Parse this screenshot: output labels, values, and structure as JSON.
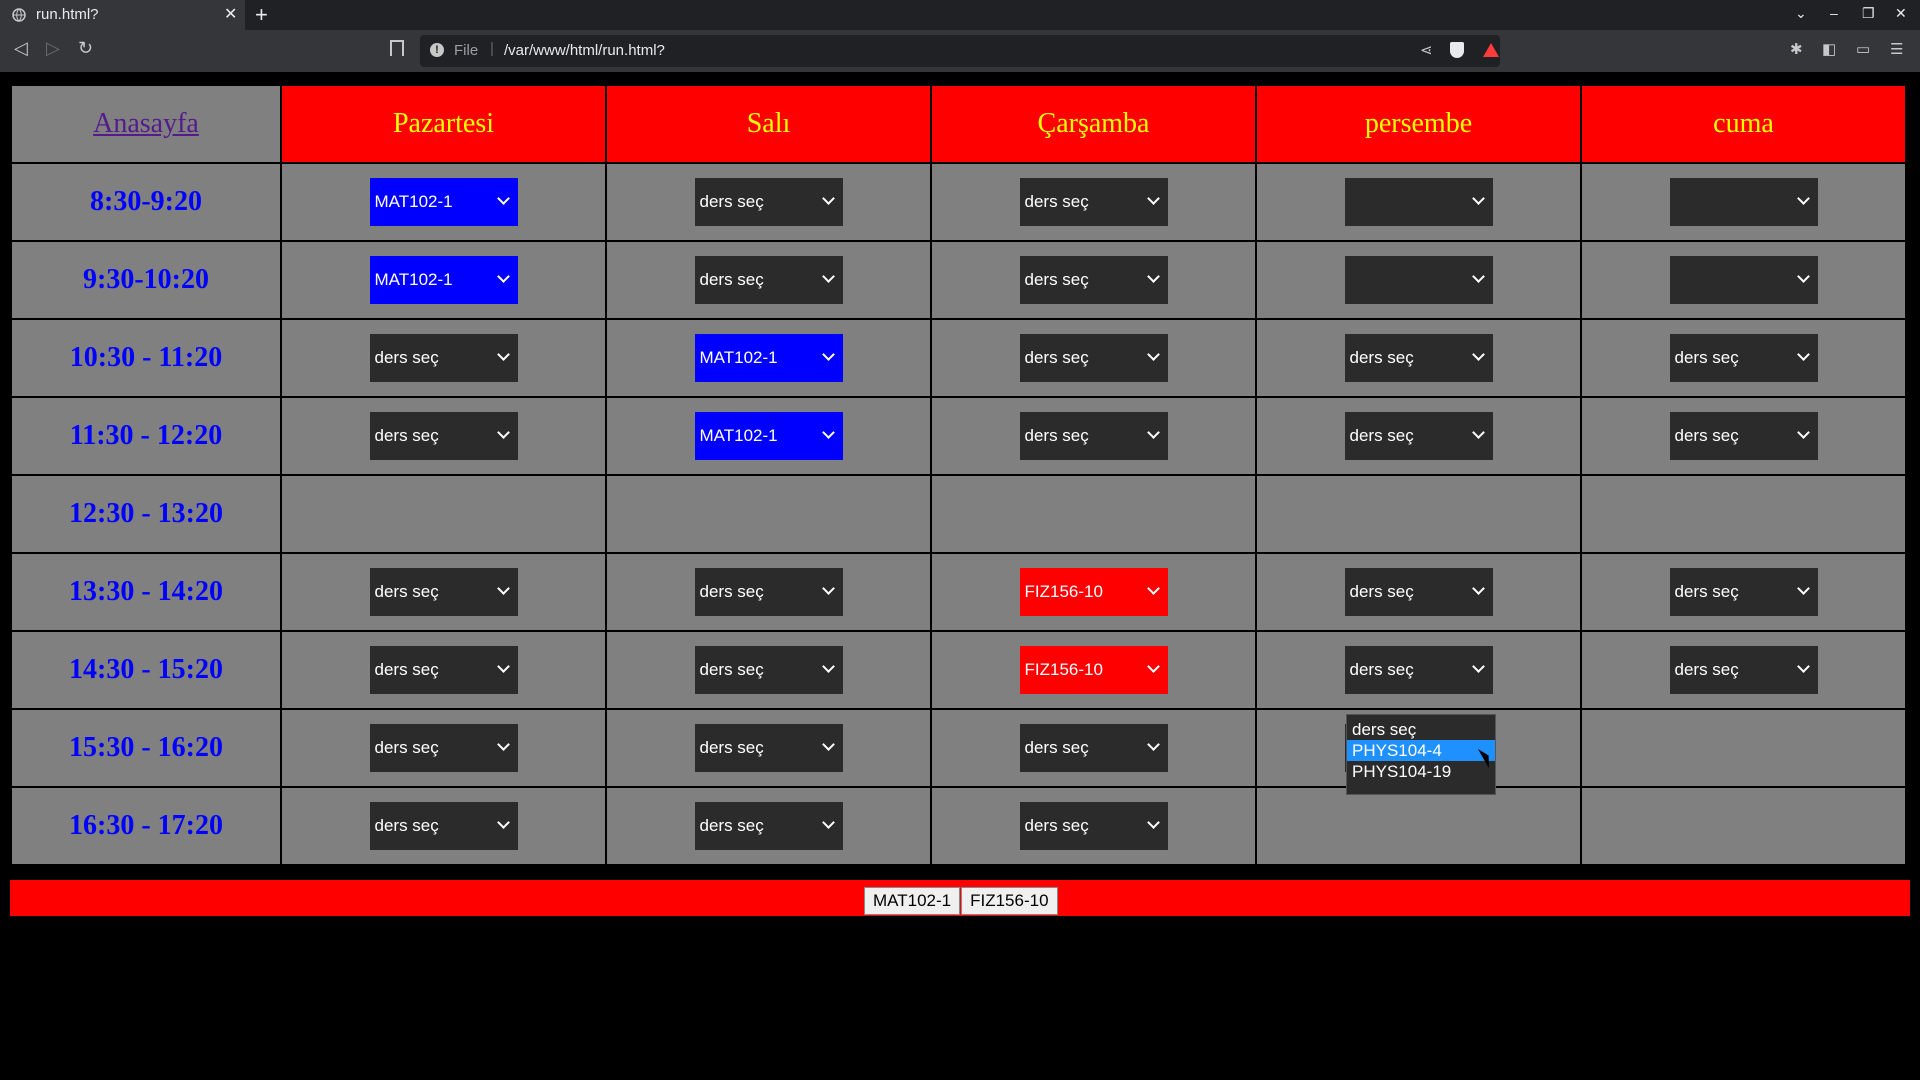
{
  "browser": {
    "tab_title": "run.html?",
    "url_scheme": "File",
    "url": "/var/www/html/run.html?"
  },
  "schedule": {
    "home_link": "Anasayfa",
    "days": [
      "Pazartesi",
      "Salı",
      "Çarşamba",
      "persembe",
      "cuma"
    ],
    "rows": [
      {
        "time": "8:30-9:20",
        "cells": [
          {
            "v": "MAT102-1",
            "c": "blue"
          },
          {
            "v": "ders seç"
          },
          {
            "v": "ders seç"
          },
          {
            "v": ""
          },
          {
            "v": ""
          }
        ]
      },
      {
        "time": "9:30-10:20",
        "cells": [
          {
            "v": "MAT102-1",
            "c": "blue"
          },
          {
            "v": "ders seç"
          },
          {
            "v": "ders seç"
          },
          {
            "v": ""
          },
          {
            "v": ""
          }
        ]
      },
      {
        "time": "10:30 - 11:20",
        "cells": [
          {
            "v": "ders seç"
          },
          {
            "v": "MAT102-1",
            "c": "blue"
          },
          {
            "v": "ders seç"
          },
          {
            "v": "ders seç"
          },
          {
            "v": "ders seç"
          }
        ]
      },
      {
        "time": "11:30 - 12:20",
        "cells": [
          {
            "v": "ders seç"
          },
          {
            "v": "MAT102-1",
            "c": "blue"
          },
          {
            "v": "ders seç"
          },
          {
            "v": "ders seç"
          },
          {
            "v": "ders seç"
          }
        ]
      },
      {
        "time": "12:30 - 13:20",
        "cells": [
          null,
          null,
          null,
          null,
          null
        ]
      },
      {
        "time": "13:30 - 14:20",
        "cells": [
          {
            "v": "ders seç"
          },
          {
            "v": "ders seç"
          },
          {
            "v": "FIZ156-10",
            "c": "red"
          },
          {
            "v": "ders seç"
          },
          {
            "v": "ders seç"
          }
        ]
      },
      {
        "time": "14:30 - 15:20",
        "cells": [
          {
            "v": "ders seç"
          },
          {
            "v": "ders seç"
          },
          {
            "v": "FIZ156-10",
            "c": "red"
          },
          {
            "v": "ders seç"
          },
          {
            "v": "ders seç"
          }
        ]
      },
      {
        "time": "15:30 - 16:20",
        "cells": [
          {
            "v": "ders seç"
          },
          {
            "v": "ders seç"
          },
          {
            "v": "ders seç"
          },
          {
            "v": "ders seç"
          },
          null
        ]
      },
      {
        "time": "16:30 - 17:20",
        "cells": [
          {
            "v": "ders seç"
          },
          {
            "v": "ders seç"
          },
          {
            "v": "ders seç"
          },
          null,
          null
        ]
      }
    ]
  },
  "open_dropdown": {
    "options": [
      "ders seç",
      "PHYS104-4",
      "PHYS104-19"
    ],
    "highlighted_index": 1
  },
  "footer": {
    "courses": [
      "MAT102-1",
      "FIZ156-10"
    ]
  },
  "colors": {
    "header_bg": "#ff0000",
    "header_text": "#ffff00",
    "time_text": "#0000ff",
    "cell_bg": "#808080",
    "selected_blue": "#0000ff",
    "selected_red": "#ff0000"
  }
}
